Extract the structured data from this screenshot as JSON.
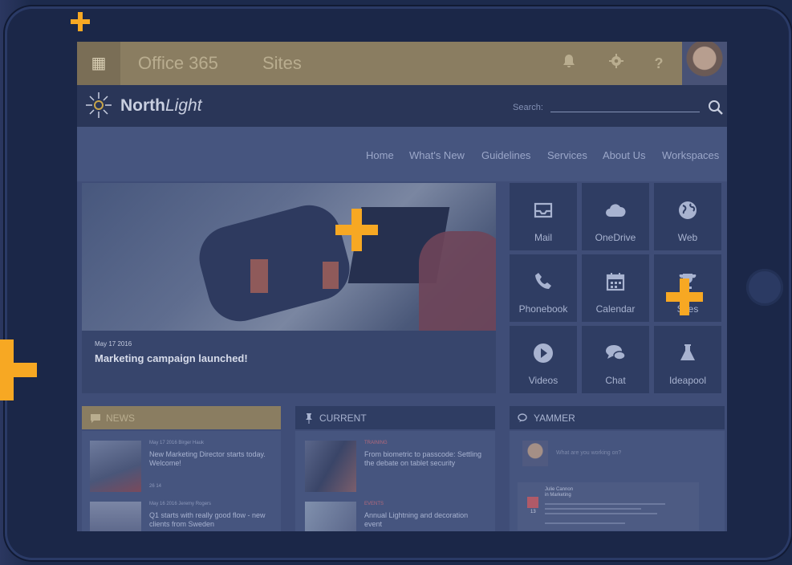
{
  "suite_bar": {
    "app_title": "Office 365",
    "section": "Sites",
    "icons": [
      "waffle-icon",
      "bell-icon",
      "gear-icon",
      "help-icon"
    ],
    "help_glyph": "?"
  },
  "brand": {
    "logo_bold": "North",
    "logo_italic": "Light",
    "search_label": "Search:"
  },
  "nav": {
    "items": [
      "Home",
      "What's New",
      "Guidelines",
      "Services",
      "About Us",
      "Workspaces"
    ]
  },
  "hero": {
    "date": "May 17 2016",
    "title": "Marketing campaign launched!"
  },
  "tiles": [
    {
      "label": "Mail",
      "icon": "inbox-icon"
    },
    {
      "label": "OneDrive",
      "icon": "cloud-icon"
    },
    {
      "label": "Web",
      "icon": "globe-icon"
    },
    {
      "label": "Phonebook",
      "icon": "phone-icon"
    },
    {
      "label": "Calendar",
      "icon": "calendar-icon"
    },
    {
      "label": "Sites",
      "icon": "trophy-icon"
    },
    {
      "label": "Videos",
      "icon": "play-icon"
    },
    {
      "label": "Chat",
      "icon": "chat-icon"
    },
    {
      "label": "Ideapool",
      "icon": "flask-icon"
    }
  ],
  "news": {
    "header": "NEWS",
    "items": [
      {
        "meta": "May 17 2016  Birger Hauk",
        "title": "New Marketing Director starts today. Welcome!",
        "stats": "26   14"
      },
      {
        "meta": "May 16 2016  Jeremy Rogers",
        "title": "Q1 starts with really good flow - new clients from Sweden"
      }
    ]
  },
  "current": {
    "header": "CURRENT",
    "items": [
      {
        "category": "TRAINING",
        "title": "From biometric to passcode: Settling the debate on tablet security"
      },
      {
        "category": "EVENTS",
        "title": "Annual Lightning and decoration event"
      }
    ]
  },
  "yammer": {
    "header": "YAMMER",
    "placeholder": "What are you working on?",
    "post_author": "Julie Cannon",
    "post_group": "in Marketing",
    "post_day": "13"
  },
  "colors": {
    "accent": "#f7a823",
    "overlay": "#1c2a4c",
    "suite_bar": "#8a7d61",
    "tile_bg": "#2f3d63"
  }
}
